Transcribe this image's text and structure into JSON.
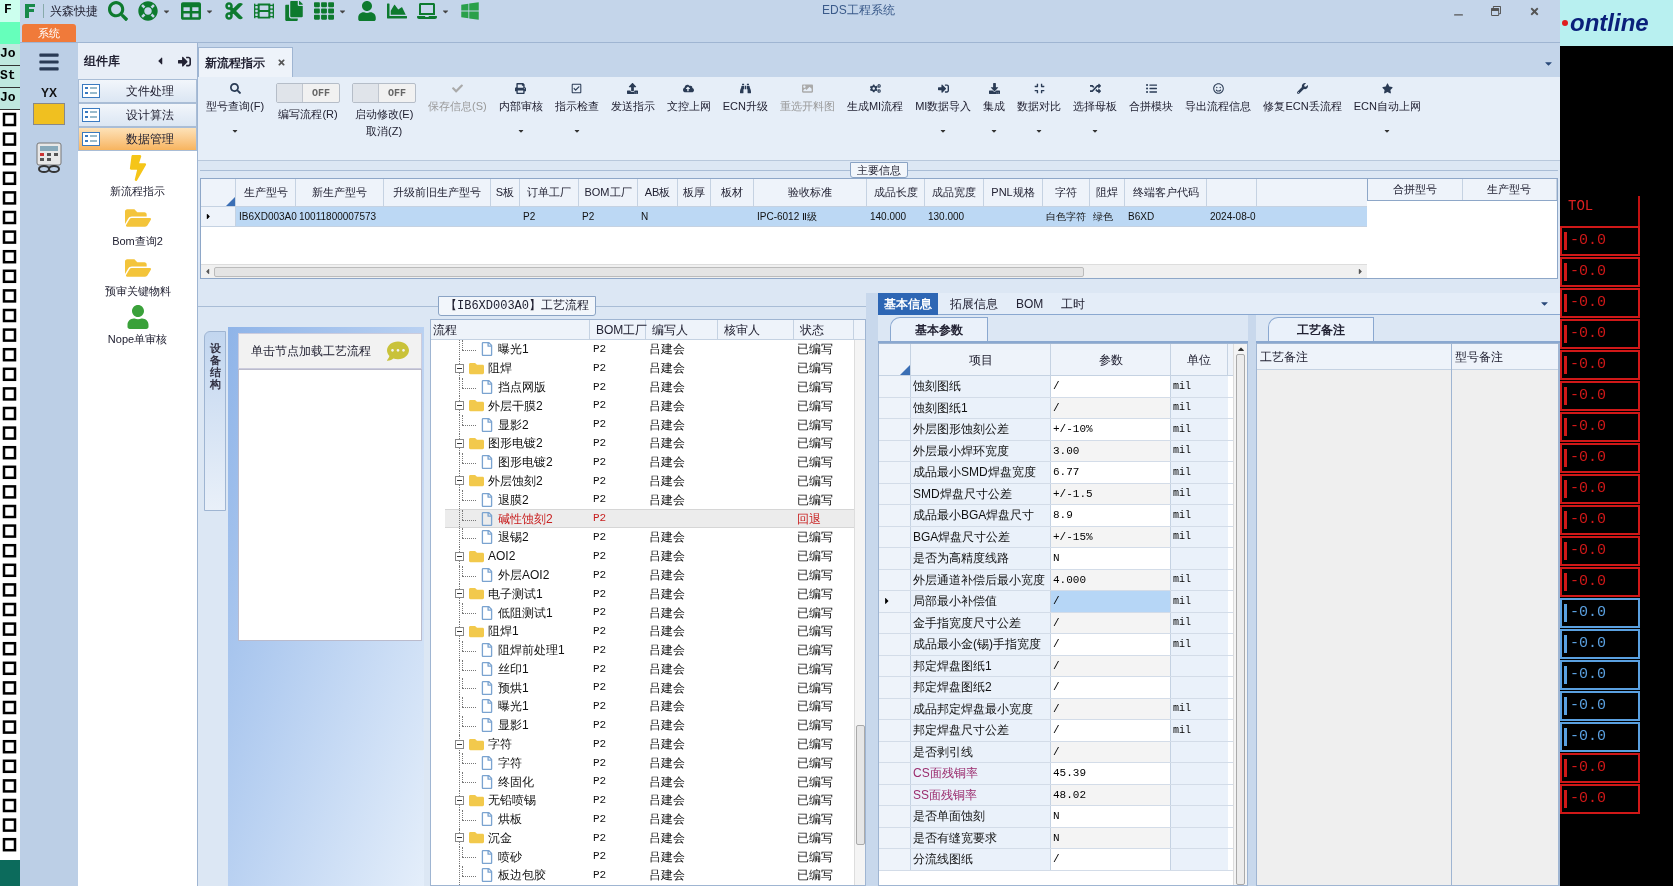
{
  "background_left": {
    "top_letter": "F",
    "labels": [
      "Jo",
      "St",
      "Jo"
    ]
  },
  "background_right": {
    "logo": "ontline",
    "column_title": "TOL",
    "cells": [
      {
        "text": "-0.0",
        "color": "#d01818"
      },
      {
        "text": "-0.0",
        "color": "#d01818"
      },
      {
        "text": "-0.0",
        "color": "#d01818"
      },
      {
        "text": "-0.0",
        "color": "#d01818"
      },
      {
        "text": "-0.0",
        "color": "#d01818"
      },
      {
        "text": "-0.0",
        "color": "#d01818"
      },
      {
        "text": "-0.0",
        "color": "#d01818"
      },
      {
        "text": "-0.0",
        "color": "#d01818"
      },
      {
        "text": "-0.0",
        "color": "#d01818"
      },
      {
        "text": "-0.0",
        "color": "#d01818"
      },
      {
        "text": "-0.0",
        "color": "#d01818"
      },
      {
        "text": "-0.0",
        "color": "#d01818"
      },
      {
        "text": "-0.0",
        "color": "#5aa0e0"
      },
      {
        "text": "-0.0",
        "color": "#5aa0e0"
      },
      {
        "text": "-0.0",
        "color": "#5aa0e0"
      },
      {
        "text": "-0.0",
        "color": "#5aa0e0"
      },
      {
        "text": "-0.0",
        "color": "#5aa0e0"
      },
      {
        "text": "-0.0",
        "color": "#d01818"
      },
      {
        "text": "-0.0",
        "color": "#d01818"
      }
    ]
  },
  "window": {
    "title": "EDS工程系统",
    "quick_access_label": "兴森快捷"
  },
  "ribbon_tabs": [
    {
      "label": "系统",
      "selected": true
    }
  ],
  "nav": {
    "logo_text": "YX"
  },
  "component_library": {
    "title": "组件库",
    "groups": [
      {
        "label": "文件处理",
        "selected": false
      },
      {
        "label": "设计算法",
        "selected": false
      },
      {
        "label": "数据管理",
        "selected": true
      }
    ],
    "items": [
      {
        "label": "新流程指示",
        "kind": "bolt"
      },
      {
        "label": "Bom查询2",
        "kind": "folder"
      },
      {
        "label": "预审关键物料",
        "kind": "folder"
      },
      {
        "label": "Nope单审核",
        "kind": "person"
      }
    ]
  },
  "document_tabs": [
    {
      "label": "新流程指示",
      "selected": true
    }
  ],
  "toolbar": [
    {
      "kind": "button",
      "label": "型号查询(F)",
      "dropdown": true,
      "disabled": false
    },
    {
      "kind": "toggle",
      "label": "编写流程(R)",
      "state_text": "OFF",
      "on": false
    },
    {
      "kind": "toggle",
      "label": "启动修改(E)\n取消(Z)",
      "state_text": "OFF",
      "on": false
    },
    {
      "kind": "button",
      "label": "保存信息(S)",
      "dropdown": false,
      "disabled": true
    },
    {
      "kind": "button",
      "label": "内部审核",
      "dropdown": true,
      "disabled": false
    },
    {
      "kind": "button",
      "label": "指示检查",
      "dropdown": true,
      "disabled": false
    },
    {
      "kind": "button",
      "label": "发送指示",
      "dropdown": false,
      "disabled": false
    },
    {
      "kind": "button",
      "label": "文控上网",
      "dropdown": false,
      "disabled": false
    },
    {
      "kind": "button",
      "label": "ECN升级",
      "dropdown": false,
      "disabled": false
    },
    {
      "kind": "button",
      "label": "重选开料图",
      "dropdown": false,
      "disabled": true
    },
    {
      "kind": "button",
      "label": "生成MI流程",
      "dropdown": false,
      "disabled": false
    },
    {
      "kind": "button",
      "label": "MI数据导入",
      "dropdown": true,
      "disabled": false
    },
    {
      "kind": "button",
      "label": "集成",
      "dropdown": true,
      "disabled": false
    },
    {
      "kind": "button",
      "label": "数据对比",
      "dropdown": true,
      "disabled": false
    },
    {
      "kind": "button",
      "label": "选择母板",
      "dropdown": true,
      "disabled": false
    },
    {
      "kind": "button",
      "label": "合拼模块",
      "dropdown": false,
      "disabled": false
    },
    {
      "kind": "button",
      "label": "导出流程信息",
      "dropdown": false,
      "disabled": false
    },
    {
      "kind": "button",
      "label": "修复ECN丢流程",
      "dropdown": false,
      "disabled": false
    },
    {
      "kind": "button",
      "label": "ECN自动上网",
      "dropdown": true,
      "disabled": false
    }
  ],
  "main_info": {
    "title": "主要信息",
    "selected_row": true,
    "columns": [
      {
        "label": "生产型号",
        "value": "IB6XD003A0"
      },
      {
        "label": "新生产型号",
        "value": "10011800007573"
      },
      {
        "label": "升级前旧生产型号"
      },
      {
        "label": "S板"
      },
      {
        "label": "订单工厂",
        "value": "P2"
      },
      {
        "label": "BOM工厂",
        "value": "P2"
      },
      {
        "label": "AB板",
        "value": "N"
      },
      {
        "label": "板厚"
      },
      {
        "label": "板材"
      },
      {
        "label": "验收标准",
        "value": "IPC-6012 Ⅱ级"
      },
      {
        "label": "成品长度",
        "value": "140.000"
      },
      {
        "label": "成品宽度",
        "value": "130.000"
      },
      {
        "label": "PNL规格"
      },
      {
        "label": "字符",
        "value": "白色字符"
      },
      {
        "label": "阻焊",
        "value": "绿色"
      },
      {
        "label": "终端客户代码",
        "value": "B6XD"
      },
      {
        "value": "2024-08-0"
      }
    ],
    "side_columns": [
      "合拼型号",
      "生产型号"
    ]
  },
  "left_pane": {
    "vertical_tab": "设备结构",
    "panel_title": "单击节点加载工艺流程"
  },
  "process_flow": {
    "title": "【IB6XD003A0】工艺流程",
    "columns": [
      "流程",
      "BOM工厂",
      "编写人",
      "核审人",
      "状态"
    ],
    "nodes": [
      {
        "kind": "step",
        "name": "曝光1",
        "factory": "P2",
        "author": "吕建会",
        "status": "已编写",
        "selected": false,
        "returned": false
      },
      {
        "kind": "group",
        "name": "阻焊",
        "factory": "P2",
        "author": "吕建会",
        "status": "已编写",
        "expanded": true,
        "children": [
          {
            "name": "挡点网版",
            "factory": "P2",
            "author": "吕建会",
            "status": "已编写",
            "selected": false,
            "returned": false
          }
        ]
      },
      {
        "kind": "group",
        "name": "外层干膜2",
        "factory": "P2",
        "author": "吕建会",
        "status": "已编写",
        "expanded": true,
        "children": [
          {
            "name": "显影2",
            "factory": "P2",
            "author": "吕建会",
            "status": "已编写",
            "selected": false,
            "returned": false
          }
        ]
      },
      {
        "kind": "group",
        "name": "图形电镀2",
        "factory": "P2",
        "author": "吕建会",
        "status": "已编写",
        "expanded": true,
        "children": [
          {
            "name": "图形电镀2",
            "factory": "P2",
            "author": "吕建会",
            "status": "已编写",
            "selected": false,
            "returned": false
          }
        ]
      },
      {
        "kind": "group",
        "name": "外层蚀刻2",
        "factory": "P2",
        "author": "吕建会",
        "status": "已编写",
        "expanded": true,
        "children": [
          {
            "name": "退膜2",
            "factory": "P2",
            "author": "吕建会",
            "status": "已编写",
            "selected": false,
            "returned": false
          },
          {
            "name": "碱性蚀刻2",
            "factory": "P2",
            "status": "回退",
            "selected": true,
            "returned": true
          },
          {
            "name": "退锡2",
            "factory": "P2",
            "author": "吕建会",
            "status": "已编写",
            "selected": false,
            "returned": false
          }
        ]
      },
      {
        "kind": "group",
        "name": "AOI2",
        "factory": "P2",
        "author": "吕建会",
        "status": "已编写",
        "expanded": true,
        "children": [
          {
            "name": "外层AOI2",
            "factory": "P2",
            "author": "吕建会",
            "status": "已编写",
            "selected": false,
            "returned": false
          }
        ]
      },
      {
        "kind": "group",
        "name": "电子测试1",
        "factory": "P2",
        "author": "吕建会",
        "status": "已编写",
        "expanded": true,
        "children": [
          {
            "name": "低阻测试1",
            "factory": "P2",
            "author": "吕建会",
            "status": "已编写",
            "selected": false,
            "returned": false
          }
        ]
      },
      {
        "kind": "group",
        "name": "阻焊1",
        "factory": "P2",
        "author": "吕建会",
        "status": "已编写",
        "expanded": true,
        "children": [
          {
            "name": "阻焊前处理1",
            "factory": "P2",
            "author": "吕建会",
            "status": "已编写",
            "selected": false,
            "returned": false
          },
          {
            "name": "丝印1",
            "factory": "P2",
            "author": "吕建会",
            "status": "已编写",
            "selected": false,
            "returned": false
          },
          {
            "name": "预烘1",
            "factory": "P2",
            "author": "吕建会",
            "status": "已编写",
            "selected": false,
            "returned": false
          },
          {
            "name": "曝光1",
            "factory": "P2",
            "author": "吕建会",
            "status": "已编写",
            "selected": false,
            "returned": false
          },
          {
            "name": "显影1",
            "factory": "P2",
            "author": "吕建会",
            "status": "已编写",
            "selected": false,
            "returned": false
          }
        ]
      },
      {
        "kind": "group",
        "name": "字符",
        "factory": "P2",
        "author": "吕建会",
        "status": "已编写",
        "expanded": true,
        "children": [
          {
            "name": "字符",
            "factory": "P2",
            "author": "吕建会",
            "status": "已编写",
            "selected": false,
            "returned": false
          },
          {
            "name": "终固化",
            "factory": "P2",
            "author": "吕建会",
            "status": "已编写",
            "selected": false,
            "returned": false
          }
        ]
      },
      {
        "kind": "group",
        "name": "无铅喷锡",
        "factory": "P2",
        "author": "吕建会",
        "status": "已编写",
        "expanded": true,
        "children": [
          {
            "name": "烘板",
            "factory": "P2",
            "author": "吕建会",
            "status": "已编写",
            "selected": false,
            "returned": false
          }
        ]
      },
      {
        "kind": "group",
        "name": "沉金",
        "factory": "P2",
        "author": "吕建会",
        "status": "已编写",
        "expanded": true,
        "children": [
          {
            "name": "喷砂",
            "factory": "P2",
            "author": "吕建会",
            "status": "已编写",
            "selected": false,
            "returned": false
          },
          {
            "name": "板边包胶",
            "factory": "P2",
            "author": "吕建会",
            "status": "已编写",
            "selected": false,
            "returned": false
          }
        ]
      }
    ]
  },
  "detail_tabs": [
    {
      "label": "基本信息",
      "selected": true
    },
    {
      "label": "拓展信息",
      "selected": false
    },
    {
      "label": "BOM",
      "selected": false
    },
    {
      "label": "工时",
      "selected": false
    }
  ],
  "basic_params": {
    "tab": "基本参数",
    "columns": [
      "项目",
      "参数",
      "单位"
    ],
    "rows": [
      {
        "item": "蚀刻图纸",
        "value": "/",
        "unit": "mil",
        "selected": false,
        "highlighted": false
      },
      {
        "item": "蚀刻图纸1",
        "value": "/",
        "unit": "mil",
        "selected": false,
        "highlighted": false
      },
      {
        "item": "外层图形蚀刻公差",
        "value": "+/-10%",
        "unit": "mil",
        "selected": false,
        "highlighted": false
      },
      {
        "item": "外层最小焊环宽度",
        "value": "3.00",
        "unit": "mil",
        "selected": false,
        "highlighted": false
      },
      {
        "item": "成品最小SMD焊盘宽度",
        "value": "6.77",
        "unit": "mil",
        "selected": false,
        "highlighted": false
      },
      {
        "item": "SMD焊盘尺寸公差",
        "value": "+/-1.5",
        "unit": "mil",
        "selected": false,
        "highlighted": false
      },
      {
        "item": "成品最小BGA焊盘尺寸",
        "value": "8.9",
        "unit": "mil",
        "selected": false,
        "highlighted": false
      },
      {
        "item": "BGA焊盘尺寸公差",
        "value": "+/-15%",
        "unit": "mil",
        "selected": false,
        "highlighted": false
      },
      {
        "item": "是否为高精度线路",
        "value": "N",
        "selected": false,
        "highlighted": false
      },
      {
        "item": "外层通道补偿后最小宽度",
        "value": "4.000",
        "unit": "mil",
        "selected": false,
        "highlighted": false
      },
      {
        "item": "局部最小补偿值",
        "value": "/",
        "unit": "mil",
        "selected": true,
        "highlighted": false
      },
      {
        "item": "金手指宽度尺寸公差",
        "value": "/",
        "unit": "mil",
        "selected": false,
        "highlighted": false
      },
      {
        "item": "成品最小金(锡)手指宽度",
        "value": "/",
        "unit": "mil",
        "selected": false,
        "highlighted": false
      },
      {
        "item": "邦定焊盘图纸1",
        "value": "/",
        "selected": false,
        "highlighted": false
      },
      {
        "item": "邦定焊盘图纸2",
        "value": "/",
        "selected": false,
        "highlighted": false
      },
      {
        "item": "成品邦定焊盘最小宽度",
        "value": "/",
        "unit": "mil",
        "selected": false,
        "highlighted": false
      },
      {
        "item": "邦定焊盘尺寸公差",
        "value": "/",
        "unit": "mil",
        "selected": false,
        "highlighted": false
      },
      {
        "item": "是否剥引线",
        "value": "/",
        "selected": false,
        "highlighted": false
      },
      {
        "item": "CS面残铜率",
        "value": "45.39",
        "selected": false,
        "highlighted": true
      },
      {
        "item": "SS面残铜率",
        "value": "48.02",
        "selected": false,
        "highlighted": true
      },
      {
        "item": "是否单面蚀刻",
        "value": "N",
        "selected": false,
        "highlighted": false
      },
      {
        "item": "是否有缝宽要求",
        "value": "N",
        "selected": false,
        "highlighted": false
      },
      {
        "item": "分流线图纸",
        "value": "/",
        "selected": false,
        "highlighted": false
      }
    ]
  },
  "process_notes": {
    "tab": "工艺备注",
    "columns": [
      "工艺备注",
      "型号备注"
    ]
  }
}
